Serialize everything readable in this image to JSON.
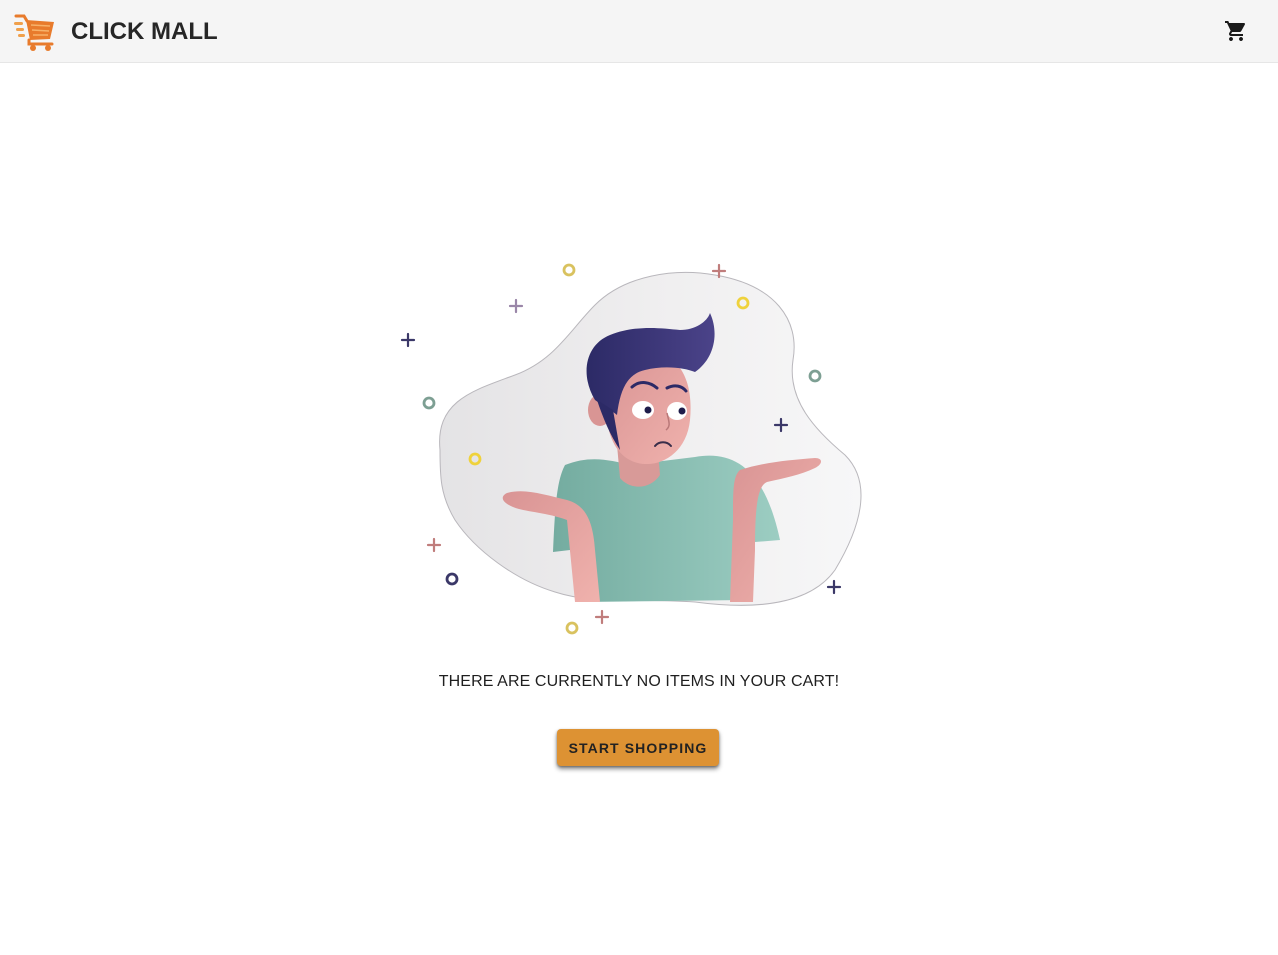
{
  "header": {
    "brand_name": "CLICK MALL",
    "logo_icon": "shopping-cart-logo-icon",
    "cart_icon": "shopping-cart-icon"
  },
  "main": {
    "illustration": "shrugging-person-illustration",
    "empty_message": "THERE ARE CURRENTLY NO ITEMS IN YOUR CART!",
    "start_shopping_label": "START SHOPPING"
  },
  "colors": {
    "accent": "#dd9233",
    "logo_orange": "#e87b2c",
    "appbar_bg": "#f5f5f5"
  }
}
